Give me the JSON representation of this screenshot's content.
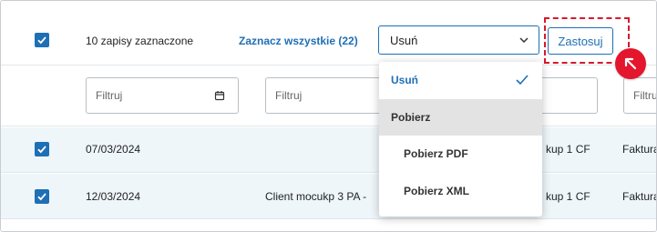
{
  "toolbar": {
    "selected_count_text": "10 zapisy zaznaczone",
    "select_all_link": "Zaznacz wszystkie (22)",
    "action_select_value": "Usuń",
    "apply_button": "Zastosuj"
  },
  "filters": {
    "placeholder": "Filtruj"
  },
  "rows": [
    {
      "checked": true,
      "date": "07/03/2024",
      "client": "",
      "col3": "kup 1 CF",
      "col4": "Faktura"
    },
    {
      "checked": true,
      "date": "12/03/2024",
      "client": "Client mocukp 3 PA -",
      "col3": "kup 1 CF",
      "col4": "Faktura"
    }
  ],
  "dropdown": {
    "options": [
      "Usuń",
      "Pobierz",
      "Pobierz PDF",
      "Pobierz XML"
    ],
    "selected": "Usuń"
  },
  "colors": {
    "accent": "#1f6fb5",
    "highlight": "#d7192b",
    "row_background": "#eef6fa"
  },
  "icons": [
    "checkbox-checked-icon",
    "chevron-down-icon",
    "calendar-icon",
    "check-icon",
    "arrow-up-left-icon"
  ]
}
